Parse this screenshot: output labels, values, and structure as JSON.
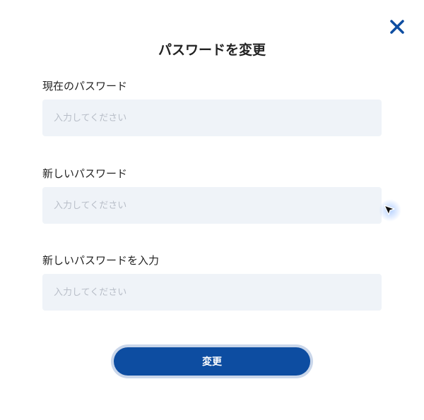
{
  "dialog": {
    "title": "パスワードを変更",
    "close_icon": "close-icon",
    "close_color": "#0d4da1"
  },
  "fields": [
    {
      "label": "現在のパスワード",
      "value": "",
      "placeholder": "入力してください"
    },
    {
      "label": "新しいパスワード",
      "value": "",
      "placeholder": "入力してください"
    },
    {
      "label": "新しいパスワードを入力",
      "value": "",
      "placeholder": "入力してください"
    }
  ],
  "submit": {
    "label": "変更",
    "color": "#0d4da1"
  },
  "cursor": {
    "icon": "mouse-pointer-icon"
  }
}
